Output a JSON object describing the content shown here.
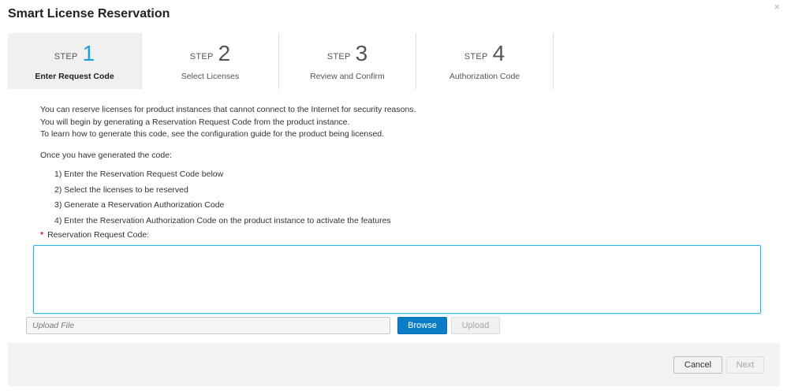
{
  "dialog": {
    "title": "Smart License Reservation",
    "close_glyph": "×"
  },
  "wizard": {
    "step_word": "STEP",
    "steps": [
      {
        "number": "1",
        "label": "Enter Request Code",
        "active": true
      },
      {
        "number": "2",
        "label": "Select Licenses",
        "active": false
      },
      {
        "number": "3",
        "label": "Review and Confirm",
        "active": false
      },
      {
        "number": "4",
        "label": "Authorization Code",
        "active": false
      }
    ],
    "active_color": "#1aa0d2"
  },
  "intro": {
    "lines": [
      "You can reserve licenses for product instances that cannot connect to the Internet for security reasons.",
      "You will begin by generating a Reservation Request Code from the product instance.",
      "To learn how to generate this code, see the configuration guide for the product being licensed."
    ],
    "once_text": "Once you have generated the code:",
    "steps": [
      "1) Enter the Reservation Request Code below",
      "2) Select the licenses to be reserved",
      "3) Generate a Reservation Authorization Code",
      "4) Enter the Reservation Authorization Code on the product instance to activate the features"
    ]
  },
  "form": {
    "required_marker": "*",
    "request_code_label": "Reservation Request Code:",
    "request_code_value": "",
    "upload_placeholder": "Upload File",
    "browse_label": "Browse",
    "upload_label": "Upload"
  },
  "footer": {
    "cancel_label": "Cancel",
    "next_label": "Next"
  },
  "colors": {
    "primary_button": "#0b7dc7",
    "required_star": "#d0271d",
    "focus_border": "#33b5e0"
  }
}
